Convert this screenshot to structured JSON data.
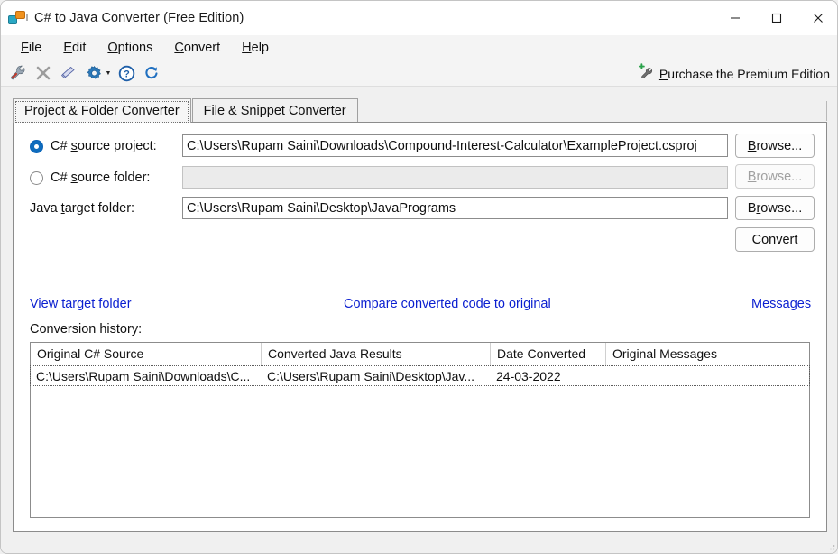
{
  "window": {
    "title": "C# to Java Converter (Free Edition)",
    "app_icon": "app-window-icon",
    "minimize": "—",
    "maximize": "☐",
    "close": "✕"
  },
  "menubar": {
    "items": [
      {
        "label": "File",
        "mnemonic": "F",
        "rest": "ile"
      },
      {
        "label": "Edit",
        "mnemonic": "E",
        "rest": "dit"
      },
      {
        "label": "Options",
        "mnemonic": "O",
        "rest": "ptions"
      },
      {
        "label": "Convert",
        "mnemonic": "C",
        "rest": "onvert"
      },
      {
        "label": "Help",
        "mnemonic": "H",
        "rest": "elp"
      }
    ]
  },
  "toolbar": {
    "icons": [
      {
        "name": "wrench-icon",
        "title": "Options"
      },
      {
        "name": "cancel-icon",
        "title": "Cancel"
      },
      {
        "name": "eraser-icon",
        "title": "Clear"
      },
      {
        "name": "gear-icon",
        "title": "Settings"
      },
      {
        "name": "help-icon",
        "title": "Help"
      },
      {
        "name": "refresh-icon",
        "title": "Refresh"
      }
    ],
    "dropdown_caret": "▼",
    "premium": {
      "icon": "wrench-plus-icon",
      "mnemonic": "P",
      "rest": "urchase the Premium Edition",
      "label": "Purchase the Premium Edition"
    }
  },
  "tabs": [
    {
      "label": "Project & Folder Converter",
      "active": true
    },
    {
      "label": "File & Snippet Converter",
      "active": false
    }
  ],
  "form": {
    "rows": [
      {
        "kind": "radio",
        "checked": true,
        "label_pre": "C# ",
        "label_mn": "s",
        "label_post": "ource project:",
        "value": "C:\\Users\\Rupam Saini\\Downloads\\Compound-Interest-Calculator\\ExampleProject.csproj",
        "disabled": false,
        "button": {
          "pre": "",
          "mn": "B",
          "post": "rowse...",
          "label": "Browse...",
          "disabled": false
        }
      },
      {
        "kind": "radio",
        "checked": false,
        "label_pre": "C# ",
        "label_mn": "s",
        "label_post": "ource folder:",
        "value": "",
        "disabled": true,
        "button": {
          "pre": "",
          "mn": "B",
          "post": "rowse...",
          "label": "Browse...",
          "disabled": true
        }
      },
      {
        "kind": "label",
        "checked": false,
        "label_pre": "Java ",
        "label_mn": "t",
        "label_post": "arget folder:",
        "value": "C:\\Users\\Rupam Saini\\Desktop\\JavaPrograms",
        "disabled": false,
        "button": {
          "pre": "B",
          "mn": "r",
          "post": "owse...",
          "label": "Browse...",
          "disabled": false
        }
      }
    ],
    "convert_button": {
      "pre": "Con",
      "mn": "v",
      "post": "ert",
      "label": "Convert"
    }
  },
  "links": {
    "view_target_folder": "View target folder",
    "compare": "Compare converted code to original",
    "messages": "Messages"
  },
  "history": {
    "caption": "Conversion history:",
    "columns": [
      "Original C# Source",
      "Converted Java Results",
      "Date Converted",
      "Original Messages"
    ],
    "rows": [
      {
        "cells": [
          "C:\\Users\\Rupam Saini\\Downloads\\C...",
          "C:\\Users\\Rupam Saini\\Desktop\\Jav...",
          "24-03-2022",
          ""
        ]
      }
    ]
  },
  "colors": {
    "accent_blue": "#0f6cbd",
    "link_blue": "#0b1fd0",
    "window_bg": "#f0f0f0",
    "panel_bg": "#ffffff",
    "border": "#8c8c8c"
  }
}
